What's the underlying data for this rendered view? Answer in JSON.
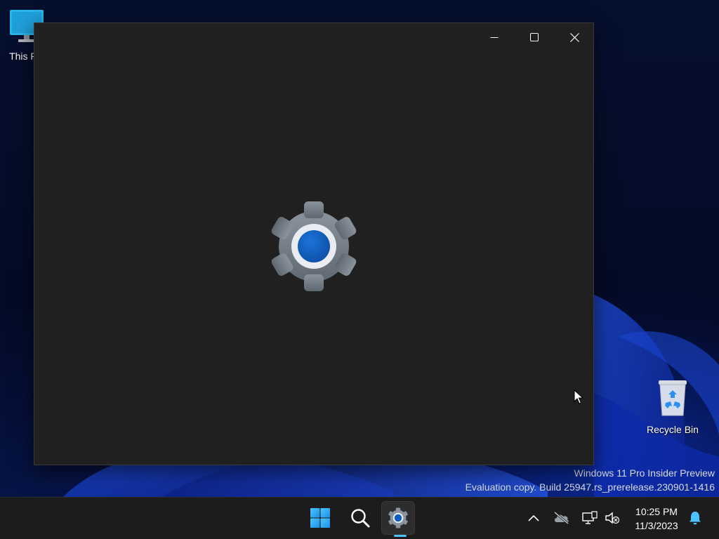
{
  "desktop": {
    "icons": [
      {
        "label": "This PC"
      },
      {
        "label": "Recycle Bin"
      }
    ]
  },
  "watermark": {
    "line1": "Windows 11 Pro Insider Preview",
    "line2": "Evaluation copy. Build 25947.rs_prerelease.230901-1416"
  },
  "window": {
    "app": "Settings",
    "state": "loading",
    "splash_icon": "settings-gear-icon",
    "controls": [
      "minimize-icon",
      "maximize-icon",
      "close-icon"
    ]
  },
  "taskbar": {
    "items": [
      "start-icon",
      "search-icon",
      "settings-app-icon"
    ],
    "active_item": "settings-app-icon",
    "tray_icons": [
      "chevron-up-icon",
      "onedrive-offline-icon",
      "network-icon",
      "volume-muted-icon",
      "notification-bell-icon"
    ],
    "clock": {
      "time": "10:25 PM",
      "date": "11/3/2023"
    }
  },
  "colors": {
    "window_bg": "#202020",
    "taskbar_bg": "#1c1c1c",
    "accent": "#4cc2ff",
    "gear_inner": "#0f5fc0"
  }
}
